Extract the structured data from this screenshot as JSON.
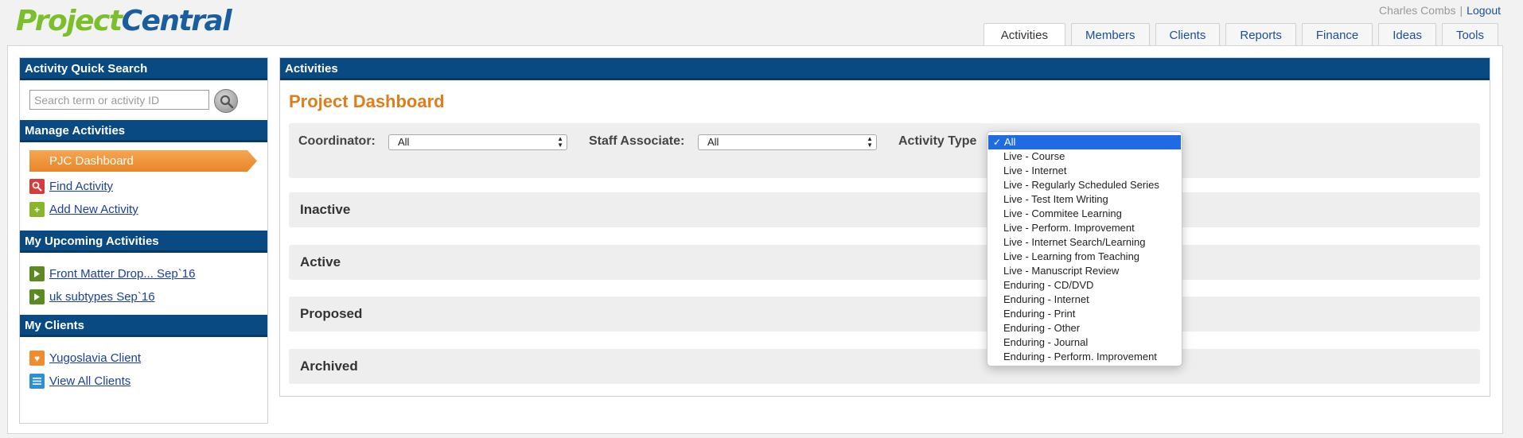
{
  "logo": {
    "part1": "Project",
    "part2": "Central"
  },
  "user": {
    "name": "Charles Combs",
    "separator": "|",
    "logout": "Logout"
  },
  "tabs": [
    "Activities",
    "Members",
    "Clients",
    "Reports",
    "Finance",
    "Ideas",
    "Tools"
  ],
  "active_tab": "Activities",
  "sidebar": {
    "quick_search": {
      "title": "Activity Quick Search",
      "placeholder": "Search term or activity ID"
    },
    "manage": {
      "title": "Manage Activities",
      "dashboard": "PJC Dashboard",
      "find": "Find Activity",
      "add": "Add New Activity"
    },
    "upcoming": {
      "title": "My Upcoming Activities",
      "items": [
        "Front Matter Drop... Sep`16",
        "uk subtypes Sep`16"
      ]
    },
    "clients": {
      "title": "My Clients",
      "items": [
        "Yugoslavia Client",
        "View All Clients"
      ]
    }
  },
  "main": {
    "header": "Activities",
    "title": "Project Dashboard",
    "filters": {
      "coordinator_label": "Coordinator:",
      "coordinator_value": "All",
      "staff_label": "Staff Associate:",
      "staff_value": "All",
      "type_label": "Activity Type"
    },
    "groups": [
      "Inactive",
      "Active",
      "Proposed",
      "Archived"
    ]
  },
  "dropdown": {
    "selected": "All",
    "options": [
      "All",
      "Live - Course",
      "Live - Internet",
      "Live - Regularly Scheduled Series",
      "Live - Test Item Writing",
      "Live - Commitee Learning",
      "Live - Perform. Improvement",
      "Live - Internet Search/Learning",
      "Live - Learning from Teaching",
      "Live - Manuscript Review",
      "Enduring - CD/DVD",
      "Enduring - Internet",
      "Enduring - Print",
      "Enduring - Other",
      "Enduring - Journal",
      "Enduring - Perform. Improvement"
    ]
  },
  "colors": {
    "header_blue": "#0a4a83",
    "title_orange": "#e07d1b",
    "selection_blue": "#1f6ce2",
    "logo_green": "#7bbf2a",
    "link_blue": "#1a3fa0"
  }
}
